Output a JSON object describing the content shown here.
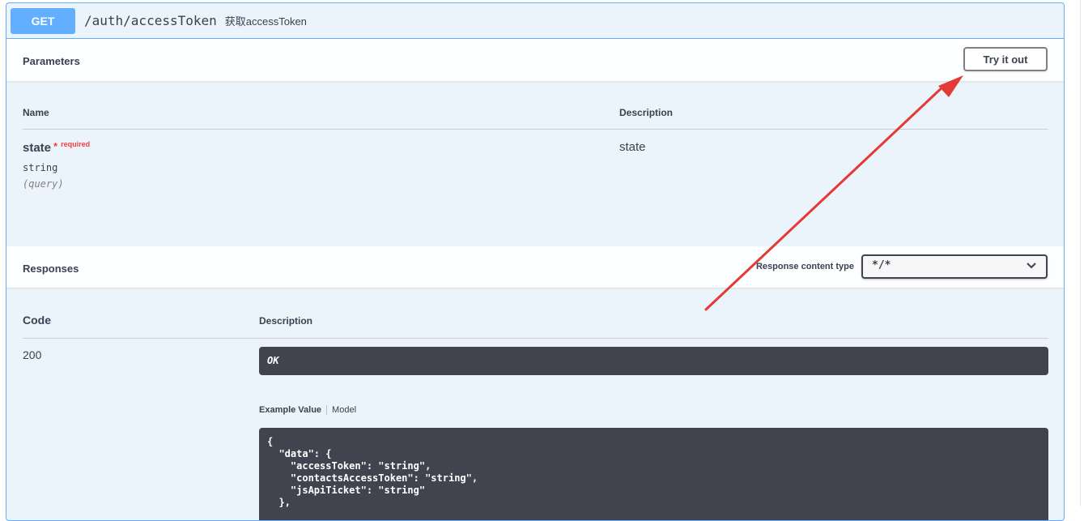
{
  "operation": {
    "method": "GET",
    "path": "/auth/accessToken",
    "summary": "获取accessToken"
  },
  "parameters": {
    "section_title": "Parameters",
    "try_button": "Try it out",
    "col_name": "Name",
    "col_description": "Description",
    "items": [
      {
        "name": "state",
        "required_star": "*",
        "required_text": "required",
        "type": "string",
        "in": "(query)",
        "description": "state"
      }
    ]
  },
  "responses": {
    "section_title": "Responses",
    "content_type_label": "Response content type",
    "content_type_value": "*/*",
    "col_code": "Code",
    "col_description": "Description",
    "items": [
      {
        "code": "200",
        "description": "OK",
        "tab_example": "Example Value",
        "tab_model": "Model",
        "example": "{\n  \"data\": {\n    \"accessToken\": \"string\",\n    \"contactsAccessToken\": \"string\",\n    \"jsApiTicket\": \"string\"\n  },"
      }
    ]
  },
  "colors": {
    "get_blue": "#61affe",
    "block_bg": "#ebf3fb",
    "dark_box": "#41444e",
    "required_red": "#f93e3e",
    "annotation_arrow": "#e53935"
  },
  "icons": {
    "select_chevron": "chevron-down-icon"
  }
}
